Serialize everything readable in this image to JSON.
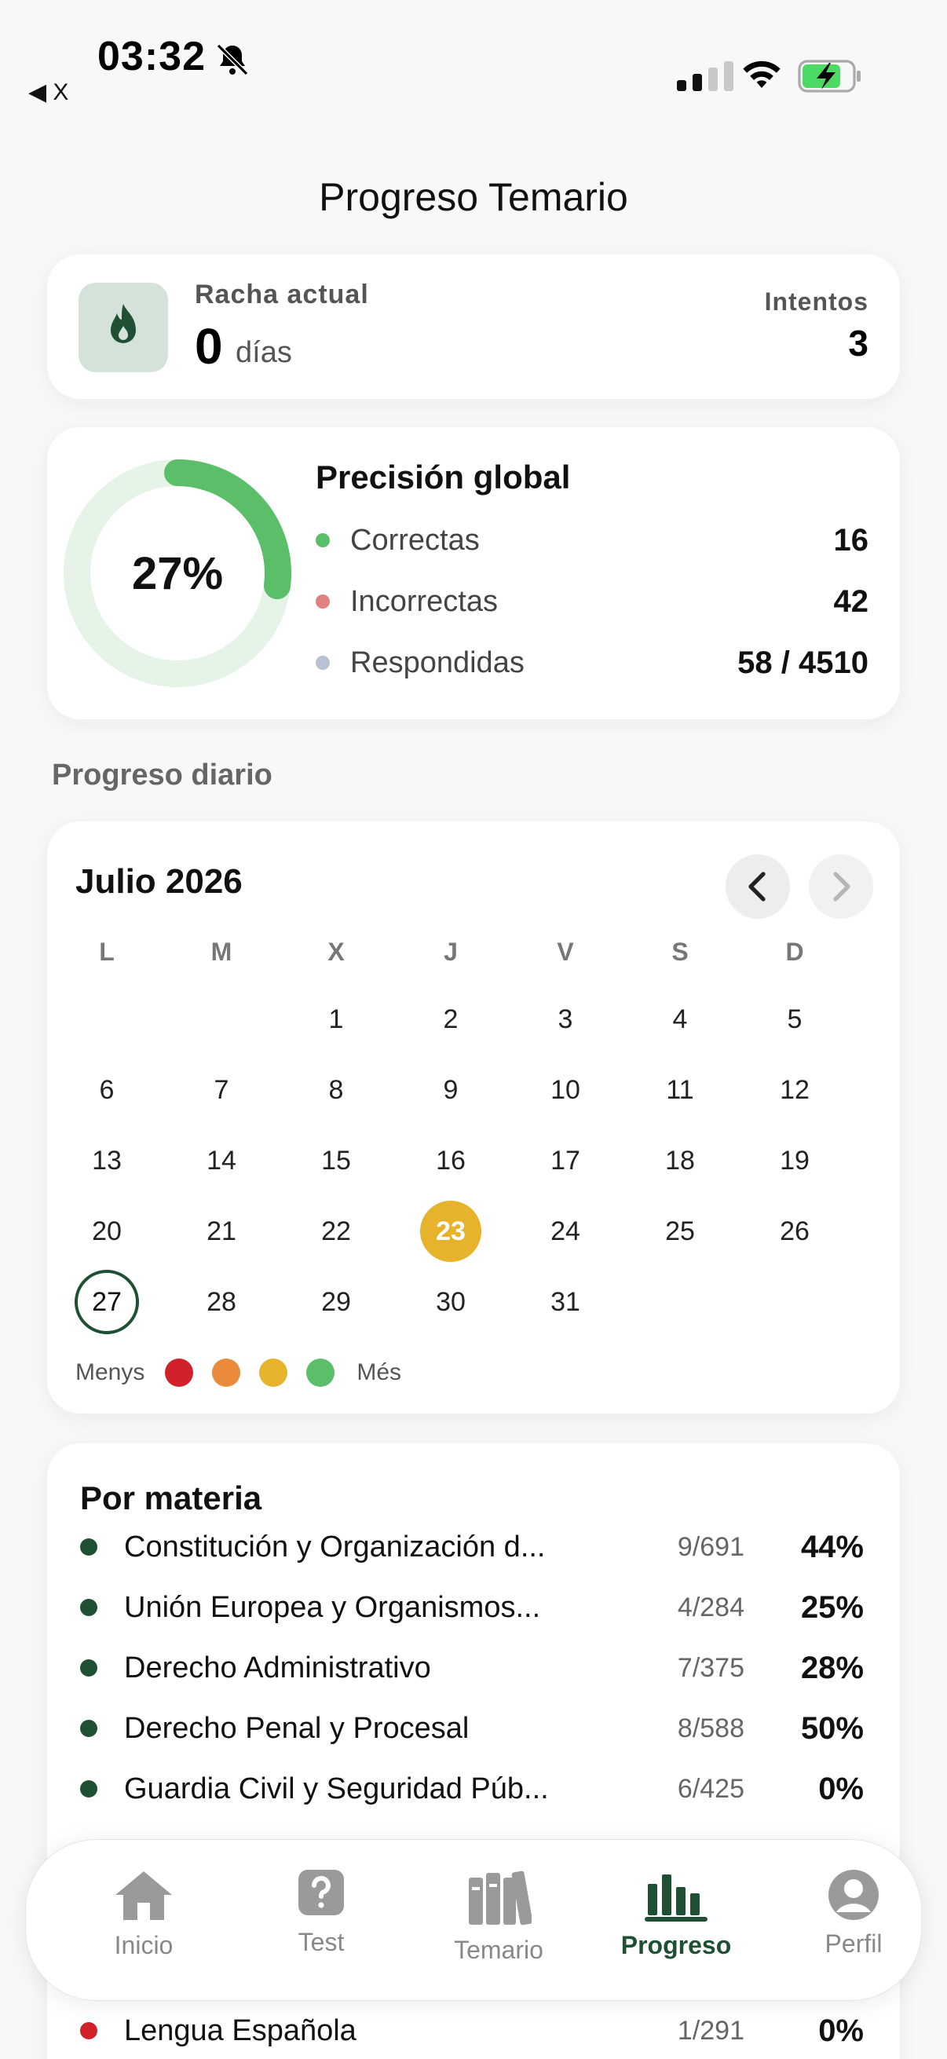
{
  "status_bar": {
    "time": "03:32",
    "back_label": "◀ X"
  },
  "page": {
    "title": "Progreso Temario"
  },
  "streak": {
    "label": "Racha actual",
    "value": "0",
    "unit": "días",
    "attempts_label": "Intentos",
    "attempts_value": "3"
  },
  "precision": {
    "percent_text": "27%",
    "percent": 0.27,
    "title": "Precisión global",
    "rows": [
      {
        "label": "Correctas",
        "value": "16",
        "color": "#5bbf6a"
      },
      {
        "label": "Incorrectas",
        "value": "42",
        "color": "#e08080"
      },
      {
        "label": "Respondidas",
        "value": "58 / 4510",
        "color": "#b8c2d0"
      }
    ]
  },
  "daily": {
    "section_label": "Progreso diario"
  },
  "calendar": {
    "title": "Julio 2026",
    "weekdays": [
      "L",
      "M",
      "X",
      "J",
      "V",
      "S",
      "D"
    ],
    "first_weekday_index": 2,
    "days_in_month": 31,
    "today": 23,
    "selected": 27,
    "legend": {
      "less": "Menys",
      "more": "Més",
      "colors": [
        "#d0202a",
        "#ec8a3c",
        "#e7b32d",
        "#5bbf6a"
      ]
    }
  },
  "subjects": {
    "title": "Por materia",
    "rows": [
      {
        "name": "Constitución y Organización d...",
        "count": "9/691",
        "percent": "44%",
        "color": "#1f5034"
      },
      {
        "name": "Unión Europea y Organismos...",
        "count": "4/284",
        "percent": "25%",
        "color": "#1f5034"
      },
      {
        "name": "Derecho Administrativo",
        "count": "7/375",
        "percent": "28%",
        "color": "#1f5034"
      },
      {
        "name": "Derecho Penal y Procesal",
        "count": "8/588",
        "percent": "50%",
        "color": "#1f5034"
      },
      {
        "name": "Guardia Civil y Seguridad Púb...",
        "count": "6/425",
        "percent": "0%",
        "color": "#1f5034"
      },
      {
        "name": "Lengua Española",
        "count": "1/291",
        "percent": "0%",
        "color": "#d0202a"
      }
    ]
  },
  "tabbar": {
    "items": [
      {
        "label": "Inicio",
        "icon": "home-icon"
      },
      {
        "label": "Test",
        "icon": "question-icon"
      },
      {
        "label": "Temario",
        "icon": "books-icon"
      },
      {
        "label": "Progreso",
        "icon": "bar-chart-icon",
        "active": true
      },
      {
        "label": "Perfil",
        "icon": "user-icon"
      }
    ]
  }
}
